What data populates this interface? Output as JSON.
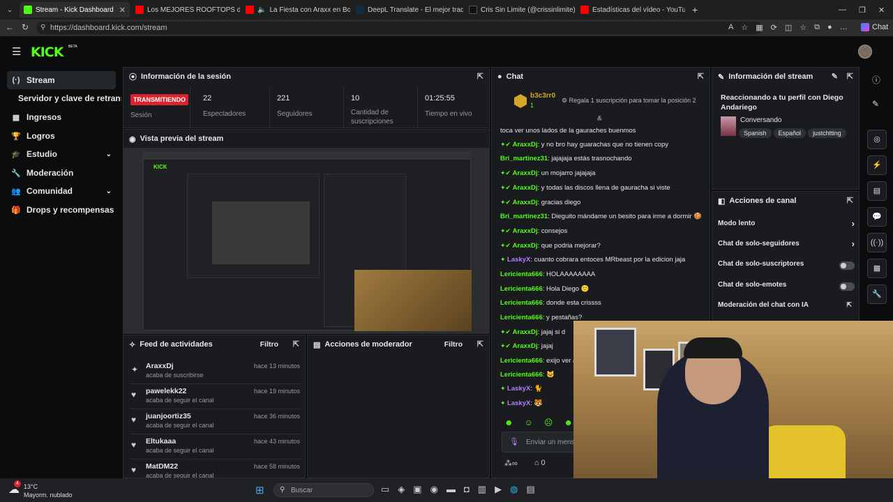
{
  "browser": {
    "tabs": [
      {
        "title": "Stream - Kick Dashboard",
        "active": true
      },
      {
        "title": "Los MEJORES ROOFTOPS de BOGO"
      },
      {
        "title": "La Fiesta con Araxx en Bogotá"
      },
      {
        "title": "DeepL Translate - El mejor traduct"
      },
      {
        "title": "Cris Sin Limite (@crissinlimite) | Ti"
      },
      {
        "title": "Estadísticas del vídeo - YouTube St"
      }
    ],
    "new_tab": "+",
    "url": "https://dashboard.kick.com/stream",
    "profile_label": "Chat"
  },
  "kick": {
    "logo": "KICK",
    "beta": "BETA"
  },
  "sidebar": [
    {
      "label": "Stream",
      "icon": "(·)",
      "active": true
    },
    {
      "label": "Servidor y clave de retransm",
      "icon": ""
    },
    {
      "label": "Ingresos",
      "icon": "▦"
    },
    {
      "label": "Logros",
      "icon": "🏆"
    },
    {
      "label": "Estudio",
      "icon": "🎓",
      "chevron": "⌄"
    },
    {
      "label": "Moderación",
      "icon": "🔧"
    },
    {
      "label": "Comunidad",
      "icon": "👥",
      "chevron": "⌄"
    },
    {
      "label": "Drops y recompensas",
      "icon": "🎁"
    }
  ],
  "session": {
    "title": "Información de la sesión",
    "status": "TRANSMITIENDO",
    "status_label": "Sesión",
    "stats": [
      {
        "value": "22",
        "label": "Espectadores"
      },
      {
        "value": "221",
        "label": "Seguidores"
      },
      {
        "value": "10",
        "label": "Cantidad de suscripciones"
      },
      {
        "value": "01:25:55",
        "label": "Tiempo en vivo"
      }
    ]
  },
  "preview": {
    "title": "Vista previa del stream"
  },
  "feed": {
    "title": "Feed de actividades",
    "filter": "Filtro",
    "items": [
      {
        "name": "AraxxDj",
        "action": "acaba de suscribirse",
        "time": "hace 13 minutos",
        "icon": "✦"
      },
      {
        "name": "pawelekk22",
        "action": "acaba de seguir el canal",
        "time": "hace 19 minutos",
        "icon": "♥"
      },
      {
        "name": "juanjoortiz35",
        "action": "acaba de seguir el canal",
        "time": "hace 36 minutos",
        "icon": "♥"
      },
      {
        "name": "Eltukaaa",
        "action": "acaba de seguir el canal",
        "time": "hace 43 minutos",
        "icon": "♥"
      },
      {
        "name": "MatDM22",
        "action": "acaba de seguir el canal",
        "time": "hace 58 minutos",
        "icon": "♥"
      }
    ]
  },
  "modactions": {
    "title": "Acciones de moderador",
    "filter": "Filtro"
  },
  "chat": {
    "title": "Chat",
    "pinned_user": "b3c3rr0",
    "pinned_count": "1",
    "gift_text": "Regala 1 suscripción para tomar la posición 2",
    "messages": [
      {
        "user": "",
        "text": "toca ver unos lados de la gauraches buenmos",
        "color": "none"
      },
      {
        "user": "AraxxDj",
        "text": ": y no bro hay guarachas que no tienen copy",
        "color": "g",
        "badges": true
      },
      {
        "user": "Bri_martinez31",
        "text": ": jajajaja estás trasnochando",
        "color": "g"
      },
      {
        "user": "AraxxDj",
        "text": ": un mojarro jajajaja",
        "color": "g",
        "badges": true
      },
      {
        "user": "AraxxDj",
        "text": ": y todas las discos llena de gauracha si viste",
        "color": "g",
        "badges": true
      },
      {
        "user": "AraxxDj",
        "text": ": gracias diego",
        "color": "g",
        "badges": true
      },
      {
        "user": "Bri_martinez31",
        "text": ": Dieguito mándame un besito para irme a dormir",
        "color": "g"
      },
      {
        "user": "AraxxDj",
        "text": ": consejos",
        "color": "g",
        "badges": true
      },
      {
        "user": "AraxxDj",
        "text": ": que podria mejorar?",
        "color": "g",
        "badges": true
      },
      {
        "user": "LaskyX",
        "text": ": cuanto cobrara entoces MRbeast por la edicion jaja",
        "color": "p",
        "badges": true
      },
      {
        "user": "Lericienta666",
        "text": ": HOLAAAAAAAA",
        "color": "g"
      },
      {
        "user": "Lericienta666",
        "text": ": Hola Diego",
        "color": "g"
      },
      {
        "user": "Lericienta666",
        "text": ": donde esta crissss",
        "color": "g"
      },
      {
        "user": "Lericienta666",
        "text": ": y pestañas?",
        "color": "g"
      },
      {
        "user": "AraxxDj",
        "text": ": jajaj si d",
        "color": "g",
        "badges": true
      },
      {
        "user": "AraxxDj",
        "text": ": jajaj",
        "color": "g",
        "badges": true
      },
      {
        "user": "Lericienta666",
        "text": ": exijo ver a",
        "color": "g"
      },
      {
        "user": "Lericienta666",
        "text": ":",
        "color": "g"
      },
      {
        "user": "LaskyX",
        "text": ":",
        "color": "p",
        "badges": true
      },
      {
        "user": "LaskyX",
        "text": ":",
        "color": "p",
        "badges": true
      }
    ],
    "input_placeholder": "Enviar un mens",
    "footer_count": "0"
  },
  "streaminfo": {
    "title": "Información del stream",
    "stream_title": "Reaccionando a tu perfil con Diego Andariego",
    "category": "Conversando",
    "tags": [
      "Spanish",
      "Español",
      "justchtting"
    ]
  },
  "channel_actions": {
    "title": "Acciones de canal",
    "rows": [
      {
        "label": "Modo lento",
        "type": "arrow"
      },
      {
        "label": "Chat de solo-seguidores",
        "type": "arrow"
      },
      {
        "label": "Chat de solo-suscriptores",
        "type": "toggle"
      },
      {
        "label": "Chat de solo-emotes",
        "type": "toggle"
      },
      {
        "label": "Moderación del chat con IA",
        "type": "link"
      }
    ]
  },
  "taskbar": {
    "temp": "13°C",
    "weather": "Mayorm. nublado",
    "search_placeholder": "Buscar",
    "notif": "4"
  },
  "colors": {
    "brand": "#53fc18",
    "live": "#d9232e",
    "panel": "#191b1f"
  }
}
